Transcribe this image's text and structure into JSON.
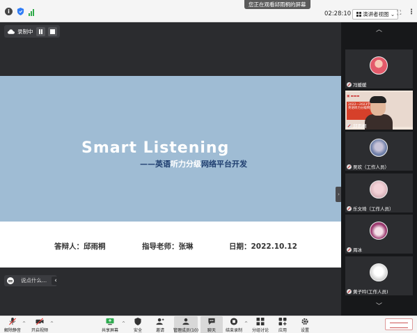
{
  "topbar": {
    "viewing_text": "您正在观看邱雨桐的屏幕",
    "timer": "02:28:10",
    "view_mode_label": "演讲者视图"
  },
  "recording": {
    "label": "录制中"
  },
  "slide": {
    "title": "Smart Listening",
    "subtitle_prefix": "——英语",
    "subtitle_highlight": "听力分级",
    "subtitle_suffix": "网络平台开发",
    "defender": "答辩人：邱雨桐",
    "advisor": "指导老师：张琳",
    "date": "日期：2022.10.12"
  },
  "chat": {
    "placeholder": "说点什么..."
  },
  "gallery": {
    "participants": [
      {
        "name": "冯媛媛",
        "avatar_color": "#e35a6a"
      },
      {
        "name": "邱雨桐",
        "video": true,
        "slide_text": [
          "2022—2023学年",
          "英语听力分级网络平台"
        ]
      },
      {
        "name": "吴欢（工作人员）",
        "avatar_color": "#6f7fa8"
      },
      {
        "name": "乐文琦（工作人员）",
        "avatar_color": "#d6b1b8"
      },
      {
        "name": "周冰",
        "avatar_color": "#9b3a6f"
      },
      {
        "name": "黄子吟(工作人员)",
        "avatar_color": "#cfcfcf"
      }
    ]
  },
  "toolbar": {
    "items": [
      {
        "label": "解除静音",
        "icon": "mic-muted-icon"
      },
      {
        "label": "开启视频",
        "icon": "camera-off-icon"
      },
      {
        "label": "共享屏幕",
        "icon": "share-screen-icon"
      },
      {
        "label": "安全",
        "icon": "shield-icon"
      },
      {
        "label": "邀请",
        "icon": "invite-icon"
      },
      {
        "label": "管理成员(10)",
        "icon": "members-icon"
      },
      {
        "label": "聊天",
        "icon": "chat-icon"
      },
      {
        "label": "结束录制",
        "icon": "stop-record-icon"
      },
      {
        "label": "分组讨论",
        "icon": "breakout-icon"
      },
      {
        "label": "应用",
        "icon": "apps-icon"
      },
      {
        "label": "设置",
        "icon": "settings-icon"
      }
    ]
  },
  "colors": {
    "slide_band": "#9fbcd4",
    "subtitle_dark": "#1f3e6f",
    "share_bg": "#2b2c2f",
    "gallery_bg": "#17181a",
    "signal_green": "#2faa4a"
  }
}
